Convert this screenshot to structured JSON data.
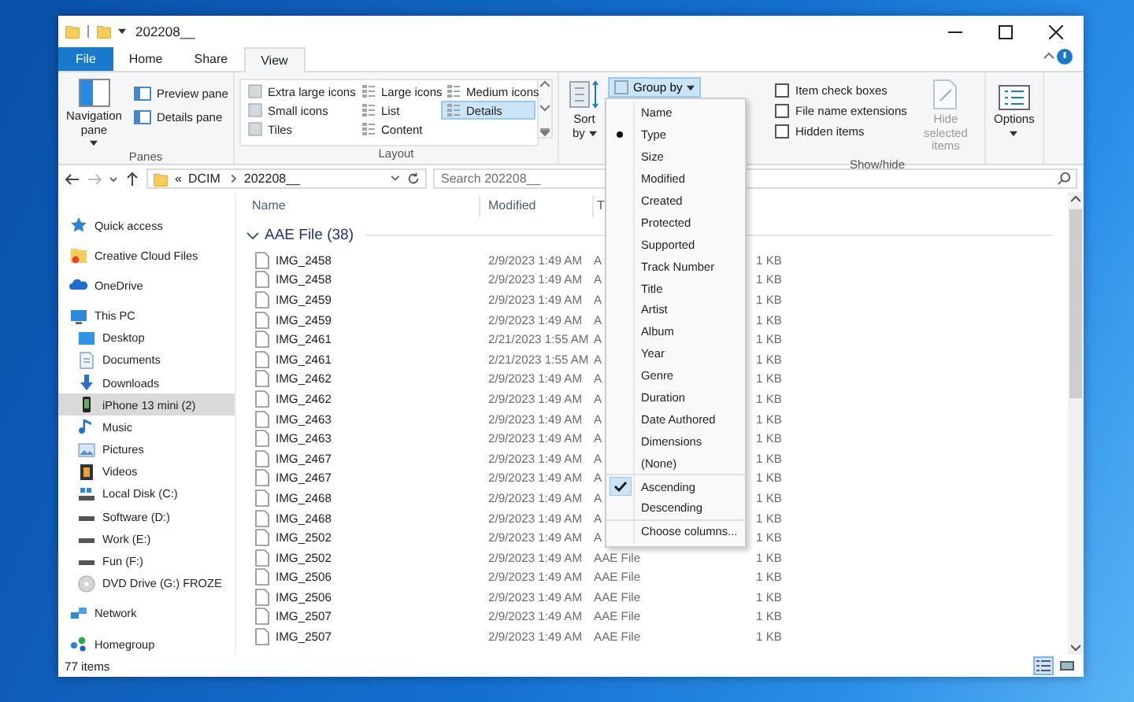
{
  "window": {
    "title": "202208__"
  },
  "ribbon_tabs": [
    {
      "label": "File",
      "kind": "file",
      "selected": false
    },
    {
      "label": "Home",
      "kind": "tab",
      "selected": false
    },
    {
      "label": "Share",
      "kind": "tab",
      "selected": false
    },
    {
      "label": "View",
      "kind": "tab",
      "selected": true
    }
  ],
  "ribbon": {
    "panes": {
      "label": "Panes",
      "navigation_pane": "Navigation pane",
      "buttons": [
        "Preview pane",
        "Details pane"
      ]
    },
    "layout": {
      "label": "Layout",
      "items": [
        {
          "label": "Extra large icons",
          "selected": false
        },
        {
          "label": "Large icons",
          "selected": false
        },
        {
          "label": "Medium icons",
          "selected": false
        },
        {
          "label": "Small icons",
          "selected": false
        },
        {
          "label": "List",
          "selected": false
        },
        {
          "label": "Details",
          "selected": true
        },
        {
          "label": "Tiles",
          "selected": false
        },
        {
          "label": "Content",
          "selected": false
        }
      ]
    },
    "current_view": {
      "sort_by": "Sort by",
      "group_by": "Group by"
    },
    "show_hide": {
      "label": "Show/hide",
      "checkboxes": [
        {
          "label": "Item check boxes",
          "checked": false
        },
        {
          "label": "File name extensions",
          "checked": false
        },
        {
          "label": "Hidden items",
          "checked": false
        }
      ],
      "hide_selected": {
        "label": "Hide selected items",
        "disabled": true
      }
    },
    "options": "Options"
  },
  "address_bar": {
    "overflow": "«",
    "path": [
      "DCIM",
      "202208__"
    ]
  },
  "search": {
    "placeholder": "Search 202208__"
  },
  "navigation": [
    {
      "label": "Quick access",
      "kind": "star",
      "selected": false
    },
    {
      "label": "Creative Cloud Files",
      "kind": "cloudfiles",
      "selected": false
    },
    {
      "label": "OneDrive",
      "kind": "cloud",
      "selected": false
    },
    {
      "label": "This PC",
      "kind": "pc",
      "selected": false,
      "children": [
        {
          "label": "Desktop",
          "kind": "desktop",
          "selected": false
        },
        {
          "label": "Documents",
          "kind": "document",
          "selected": false
        },
        {
          "label": "Downloads",
          "kind": "download",
          "selected": false
        },
        {
          "label": "iPhone 13 mini (2)",
          "kind": "phone",
          "selected": true
        },
        {
          "label": "Music",
          "kind": "music",
          "selected": false
        },
        {
          "label": "Pictures",
          "kind": "pictures",
          "selected": false
        },
        {
          "label": "Videos",
          "kind": "video",
          "selected": false
        },
        {
          "label": "Local Disk (C:)",
          "kind": "system",
          "selected": false
        },
        {
          "label": "Software (D:)",
          "kind": "drive",
          "selected": false
        },
        {
          "label": "Work (E:)",
          "kind": "drive",
          "selected": false
        },
        {
          "label": "Fun (F:)",
          "kind": "drive",
          "selected": false
        },
        {
          "label": "DVD Drive (G:) FROZE",
          "kind": "disc",
          "selected": false
        }
      ]
    },
    {
      "label": "Network",
      "kind": "network",
      "selected": false
    },
    {
      "label": "Homegroup",
      "kind": "homegroup",
      "selected": false
    }
  ],
  "file_list": {
    "columns": [
      "Name",
      "Modified",
      "T"
    ],
    "group": {
      "label": "AAE File (38)",
      "expanded": true
    },
    "rows": [
      {
        "name": "IMG_2458",
        "modified": "2/9/2023 1:49 AM",
        "type": "A",
        "size": "1 KB"
      },
      {
        "name": "IMG_2458",
        "modified": "2/9/2023 1:49 AM",
        "type": "A",
        "size": "1 KB"
      },
      {
        "name": "IMG_2459",
        "modified": "2/9/2023 1:49 AM",
        "type": "A",
        "size": "1 KB"
      },
      {
        "name": "IMG_2459",
        "modified": "2/9/2023 1:49 AM",
        "type": "A",
        "size": "1 KB"
      },
      {
        "name": "IMG_2461",
        "modified": "2/21/2023 1:55 AM",
        "type": "A",
        "size": "1 KB"
      },
      {
        "name": "IMG_2461",
        "modified": "2/21/2023 1:55 AM",
        "type": "A",
        "size": "1 KB"
      },
      {
        "name": "IMG_2462",
        "modified": "2/9/2023 1:49 AM",
        "type": "A",
        "size": "1 KB"
      },
      {
        "name": "IMG_2462",
        "modified": "2/9/2023 1:49 AM",
        "type": "A",
        "size": "1 KB"
      },
      {
        "name": "IMG_2463",
        "modified": "2/9/2023 1:49 AM",
        "type": "A",
        "size": "1 KB"
      },
      {
        "name": "IMG_2463",
        "modified": "2/9/2023 1:49 AM",
        "type": "A",
        "size": "1 KB"
      },
      {
        "name": "IMG_2467",
        "modified": "2/9/2023 1:49 AM",
        "type": "A",
        "size": "1 KB"
      },
      {
        "name": "IMG_2467",
        "modified": "2/9/2023 1:49 AM",
        "type": "A",
        "size": "1 KB"
      },
      {
        "name": "IMG_2468",
        "modified": "2/9/2023 1:49 AM",
        "type": "A",
        "size": "1 KB"
      },
      {
        "name": "IMG_2468",
        "modified": "2/9/2023 1:49 AM",
        "type": "A",
        "size": "1 KB"
      },
      {
        "name": "IMG_2502",
        "modified": "2/9/2023 1:49 AM",
        "type": "A",
        "size": "1 KB"
      },
      {
        "name": "IMG_2502",
        "modified": "2/9/2023 1:49 AM",
        "type": "AAE File",
        "size": "1 KB"
      },
      {
        "name": "IMG_2506",
        "modified": "2/9/2023 1:49 AM",
        "type": "AAE File",
        "size": "1 KB"
      },
      {
        "name": "IMG_2506",
        "modified": "2/9/2023 1:49 AM",
        "type": "AAE File",
        "size": "1 KB"
      },
      {
        "name": "IMG_2507",
        "modified": "2/9/2023 1:49 AM",
        "type": "AAE File",
        "size": "1 KB"
      },
      {
        "name": "IMG_2507",
        "modified": "2/9/2023 1:49 AM",
        "type": "AAE File",
        "size": "1 KB"
      }
    ]
  },
  "group_by_menu": [
    {
      "label": "Name",
      "kind": "option",
      "selected": false
    },
    {
      "label": "Type",
      "kind": "option",
      "selected": true
    },
    {
      "label": "Size",
      "kind": "option",
      "selected": false
    },
    {
      "label": "Modified",
      "kind": "option",
      "selected": false
    },
    {
      "label": "Created",
      "kind": "option",
      "selected": false
    },
    {
      "label": "Protected",
      "kind": "option",
      "selected": false
    },
    {
      "label": "Supported",
      "kind": "option",
      "selected": false
    },
    {
      "label": "Track Number",
      "kind": "option",
      "selected": false
    },
    {
      "label": "Title",
      "kind": "option",
      "selected": false
    },
    {
      "label": "Artist",
      "kind": "option",
      "selected": false
    },
    {
      "label": "Album",
      "kind": "option",
      "selected": false
    },
    {
      "label": "Year",
      "kind": "option",
      "selected": false
    },
    {
      "label": "Genre",
      "kind": "option",
      "selected": false
    },
    {
      "label": "Duration",
      "kind": "option",
      "selected": false
    },
    {
      "label": "Date Authored",
      "kind": "option",
      "selected": false
    },
    {
      "label": "Dimensions",
      "kind": "option",
      "selected": false
    },
    {
      "label": "(None)",
      "kind": "option",
      "selected": false
    },
    {
      "label": "Ascending",
      "kind": "order",
      "selected": true
    },
    {
      "label": "Descending",
      "kind": "order",
      "selected": false
    },
    {
      "label": "Choose columns...",
      "kind": "command"
    }
  ],
  "status_bar": {
    "count": "77 items"
  },
  "view_buttons": [
    {
      "kind": "details",
      "selected": true
    },
    {
      "kind": "thumbnails",
      "selected": false
    }
  ]
}
